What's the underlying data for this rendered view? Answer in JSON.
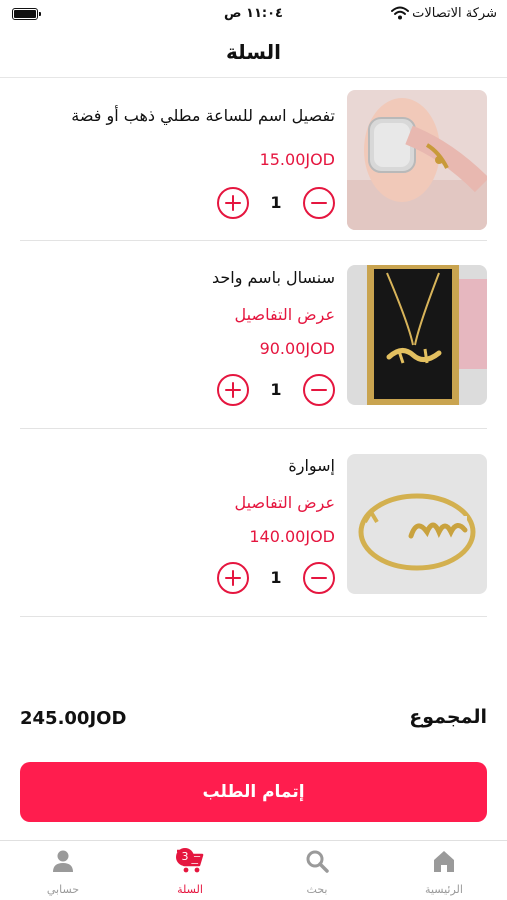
{
  "status_bar": {
    "carrier": "شركة الاتصالات",
    "time": "١١:٠٤ ص"
  },
  "header": {
    "title": "السلة"
  },
  "cart": {
    "items": [
      {
        "name": "تفصيل اسم للساعة مطلي ذهب أو فضة",
        "details_label": "",
        "price": "15.00JOD",
        "quantity": "1",
        "image": "watch-strap-name-charm-photo"
      },
      {
        "name": "سنسال باسم واحد",
        "details_label": "عرض التفاصيل",
        "price": "90.00JOD",
        "quantity": "1",
        "image": "gold-name-necklace-photo"
      },
      {
        "name": "إسوارة",
        "details_label": "عرض التفاصيل",
        "price": "140.00JOD",
        "quantity": "1",
        "image": "gold-name-bracelet-photo"
      }
    ]
  },
  "summary": {
    "total_label": "المجموع",
    "total_value": "245.00JOD"
  },
  "checkout": {
    "label": "إتمام الطلب"
  },
  "tab_bar": {
    "tabs": [
      {
        "label": "الرئيسية",
        "icon": "home-icon"
      },
      {
        "label": "بحث",
        "icon": "search-icon"
      },
      {
        "label": "السلة",
        "icon": "cart-icon",
        "badge": "3"
      },
      {
        "label": "حسابي",
        "icon": "user-icon"
      }
    ]
  },
  "colors": {
    "accent": "#e5163f",
    "button": "#ff1d4e",
    "inactive_tab": "#9a9a9a"
  }
}
